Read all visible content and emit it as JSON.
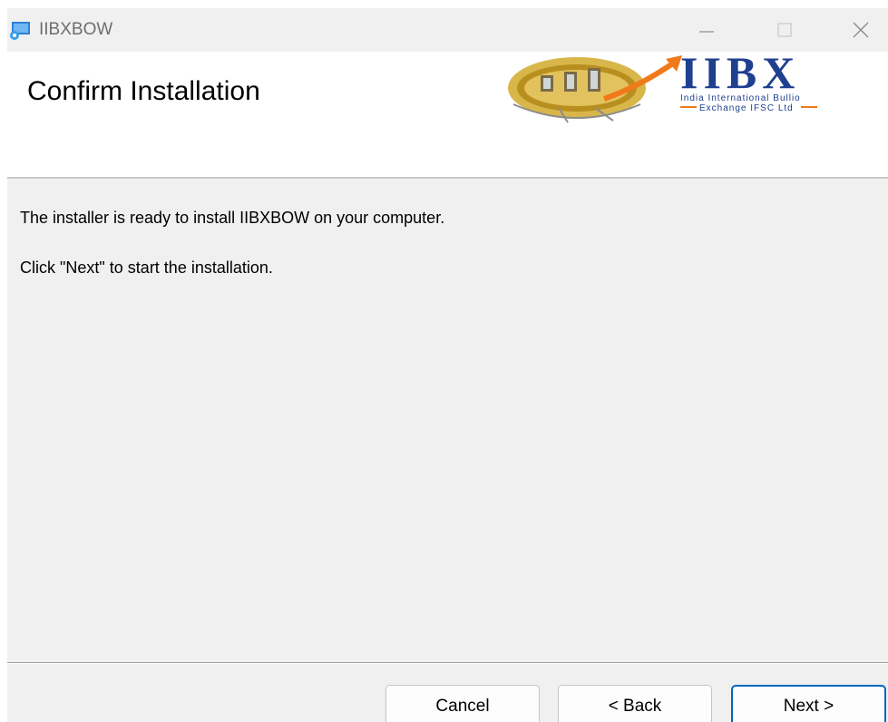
{
  "window": {
    "title": "IIBXBOW"
  },
  "header": {
    "title": "Confirm Installation",
    "logo": {
      "name": "IIBX",
      "line1": "India International Bullio",
      "line2": "Exchange IFSC Ltd"
    }
  },
  "body": {
    "line1": "The installer is ready to install IIBXBOW on your computer.",
    "line2": "Click \"Next\" to start the installation."
  },
  "buttons": {
    "cancel": "Cancel",
    "back": "< Back",
    "next": "Next >"
  },
  "colors": {
    "accent": "#0067c0",
    "logo_blue": "#1f3f8f",
    "logo_orange": "#f07a1a",
    "coin_gold": "#c9a227"
  },
  "icons": {
    "app": "installer-icon",
    "minimize": "minimize-icon",
    "maximize": "maximize-icon",
    "close": "close-icon"
  }
}
